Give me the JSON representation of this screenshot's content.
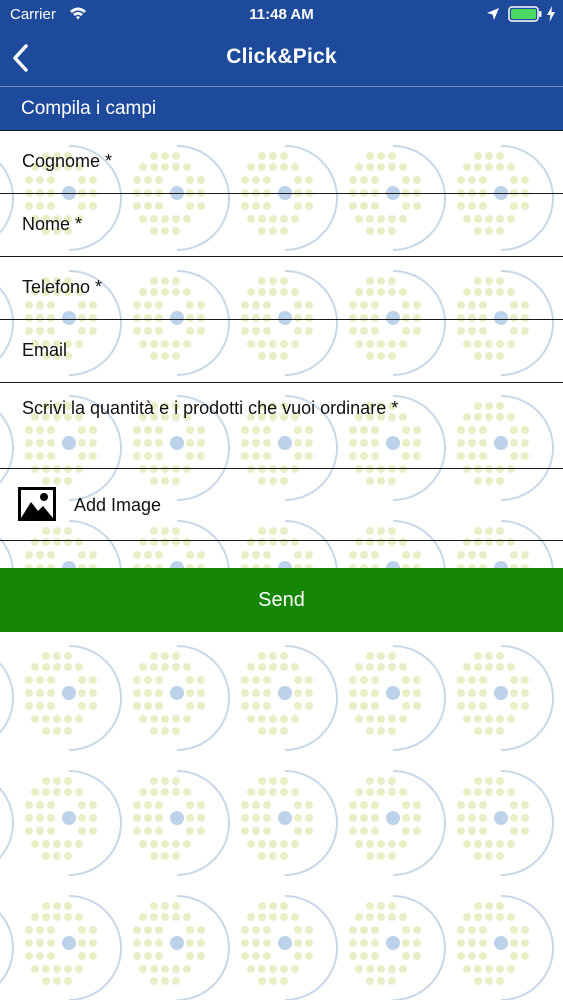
{
  "status_bar": {
    "carrier": "Carrier",
    "time": "11:48 AM",
    "icons": {
      "wifi": "wifi-icon",
      "location": "location-arrow-icon",
      "battery": "battery-full-icon",
      "charging": "bolt-icon"
    }
  },
  "nav": {
    "title": "Click&Pick",
    "back_icon": "chevron-left-icon"
  },
  "section": {
    "title": "Compila i campi"
  },
  "fields": [
    {
      "label": "Cognome *"
    },
    {
      "label": "Nome *"
    },
    {
      "label": "Telefono *"
    },
    {
      "label": "Email"
    },
    {
      "label": "Scrivi la quantità e i prodotti che vuoi ordinare *"
    }
  ],
  "image_picker": {
    "label": "Add Image",
    "icon": "image-icon"
  },
  "send": {
    "label": "Send"
  },
  "colors": {
    "header": "#1e4a9b",
    "send": "#168704",
    "pattern_dots": "#e7efc6",
    "pattern_ring": "#c7d8e9"
  }
}
